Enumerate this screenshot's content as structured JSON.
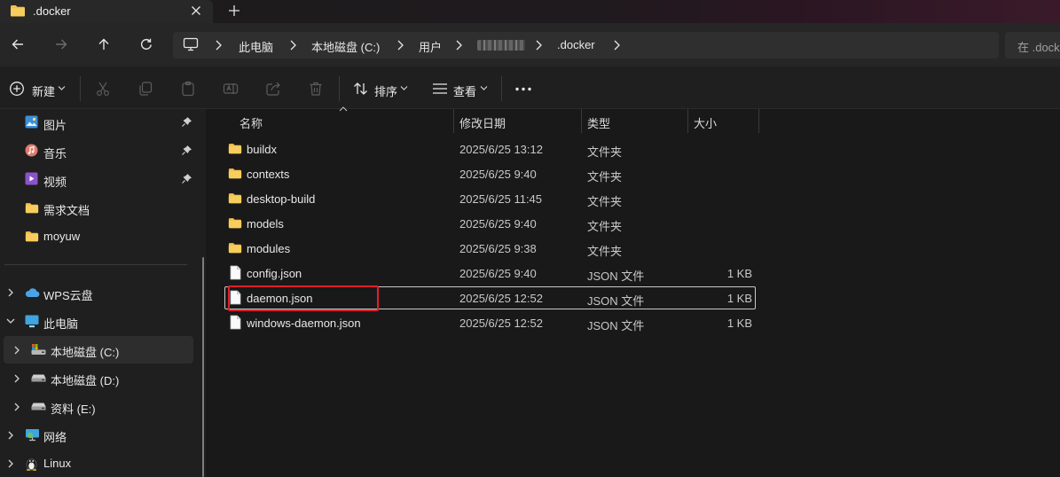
{
  "tab": {
    "title": ".docker"
  },
  "breadcrumb": {
    "items": [
      "此电脑",
      "本地磁盘 (C:)",
      "用户",
      "",
      ".docker"
    ]
  },
  "search": {
    "placeholder": "在 .dock"
  },
  "toolbar": {
    "new_label": "新建",
    "sort_label": "排序",
    "view_label": "查看"
  },
  "sidebar": {
    "quick_access": [
      {
        "label": "图片",
        "icon": "pictures-icon",
        "pinned": true
      },
      {
        "label": "音乐",
        "icon": "music-icon",
        "pinned": true
      },
      {
        "label": "视频",
        "icon": "videos-icon",
        "pinned": true
      },
      {
        "label": "需求文档",
        "icon": "folder-icon",
        "pinned": false
      },
      {
        "label": "moyuw",
        "icon": "folder-icon",
        "pinned": false
      }
    ],
    "tree": [
      {
        "label": "WPS云盘",
        "icon": "cloud-icon"
      },
      {
        "label": "此电脑",
        "icon": "pc-icon",
        "expanded": true
      },
      {
        "label": "本地磁盘 (C:)",
        "icon": "system-drive-icon",
        "selected": true
      },
      {
        "label": "本地磁盘 (D:)",
        "icon": "drive-icon"
      },
      {
        "label": "资料 (E:)",
        "icon": "drive-icon"
      },
      {
        "label": "网络",
        "icon": "network-icon"
      },
      {
        "label": "Linux",
        "icon": "linux-icon"
      }
    ]
  },
  "columns": {
    "name": "名称",
    "modified": "修改日期",
    "type": "类型",
    "size": "大小"
  },
  "files": [
    {
      "name": "buildx",
      "date": "2025/6/25 13:12",
      "type": "文件夹",
      "size": "",
      "kind": "folder"
    },
    {
      "name": "contexts",
      "date": "2025/6/25 9:40",
      "type": "文件夹",
      "size": "",
      "kind": "folder"
    },
    {
      "name": "desktop-build",
      "date": "2025/6/25 11:45",
      "type": "文件夹",
      "size": "",
      "kind": "folder"
    },
    {
      "name": "models",
      "date": "2025/6/25 9:40",
      "type": "文件夹",
      "size": "",
      "kind": "folder"
    },
    {
      "name": "modules",
      "date": "2025/6/25 9:38",
      "type": "文件夹",
      "size": "",
      "kind": "folder"
    },
    {
      "name": "config.json",
      "date": "2025/6/25 9:40",
      "type": "JSON 文件",
      "size": "1 KB",
      "kind": "file"
    },
    {
      "name": "daemon.json",
      "date": "2025/6/25 12:52",
      "type": "JSON 文件",
      "size": "1 KB",
      "kind": "file"
    },
    {
      "name": "windows-daemon.json",
      "date": "2025/6/25 12:52",
      "type": "JSON 文件",
      "size": "1 KB",
      "kind": "file"
    }
  ],
  "colors": {
    "folder": "#f3c04d",
    "highlight": "#e0202c",
    "selection": "#c9c9c9"
  }
}
